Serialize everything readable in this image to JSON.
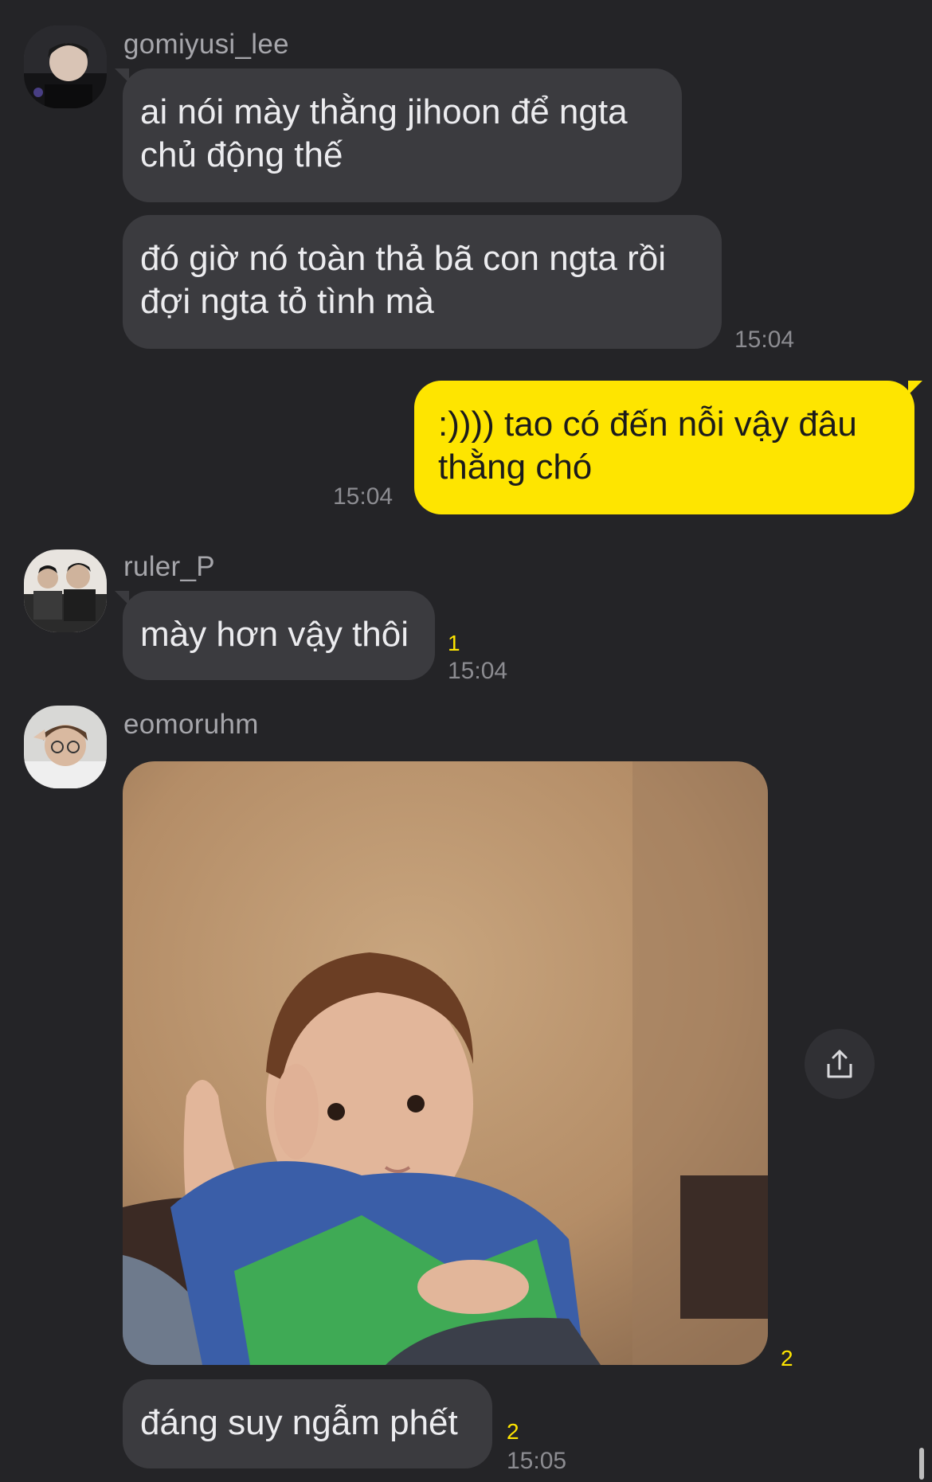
{
  "messages": [
    {
      "sender": "gomiyusi_lee",
      "bubbles": [
        "ai nói mày thằng jihoon để ngta chủ động thế",
        "đó giờ nó toàn thả bã con ngta rồi đợi ngta tỏ tình mà"
      ],
      "time": "15:04"
    },
    {
      "sender": "me",
      "bubbles": [
        ":)))) tao có đến nỗi vậy đâu thằng chó"
      ],
      "time": "15:04"
    },
    {
      "sender": "ruler_P",
      "bubbles": [
        "mày hơn vậy thôi"
      ],
      "unread": "1",
      "time": "15:04"
    },
    {
      "sender": "eomoruhm",
      "photo_unread": "2",
      "bubbles": [
        "đáng suy ngẫm phết"
      ],
      "unread": "2",
      "time": "15:05"
    }
  ],
  "colors": {
    "background": "#242427",
    "bubble_other": "#3b3b3f",
    "bubble_mine": "#fee500",
    "unread_count": "#fee500"
  },
  "icons": {
    "share": "share-icon"
  }
}
